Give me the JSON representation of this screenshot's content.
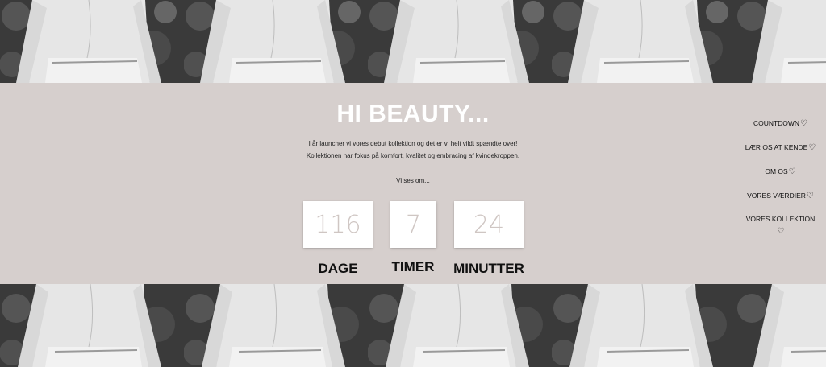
{
  "hero": {
    "title": "HI BEAUTY...",
    "line1": "I år launcher vi vores debut kollektion og det er vi helt vildt spændte over!",
    "line2": "Kollektionen har fokus på komfort, kvalitet og embracing af kvindekroppen.",
    "line3": "Vi ses om..."
  },
  "countdown": {
    "days": "116",
    "hours": "7",
    "minutes": "24",
    "days_label": "DAGE",
    "hours_label": "TIMER",
    "minutes_label": "MINUTTER"
  },
  "nav": {
    "items": [
      {
        "label": "COUNTDOWN"
      },
      {
        "label": "LÆR OS AT KENDE"
      },
      {
        "label": "OM OS"
      },
      {
        "label": "VORES VÆRDIER"
      },
      {
        "label": "VORES KOLLEKTION"
      }
    ],
    "heart_glyph": "♡"
  },
  "colors": {
    "band": "#d6cfcd",
    "box_text": "#cfc6c3",
    "title": "#ffffff"
  }
}
